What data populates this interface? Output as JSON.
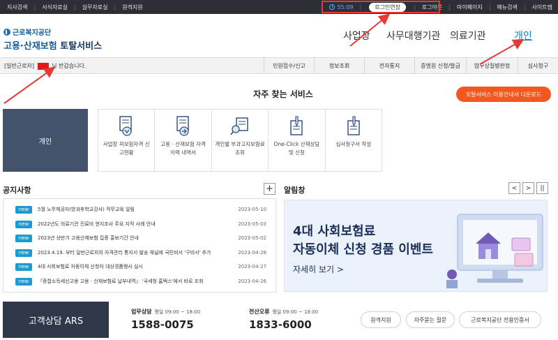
{
  "topbar": {
    "left_links": [
      "지사검색",
      "서식자료실",
      "실무자료실",
      "원격지원"
    ],
    "timer": "55:09",
    "extend_label": "로그인연장",
    "logout_label": "로그아웃",
    "right_links": [
      "마이페이지",
      "메뉴검색",
      "사이트맵"
    ]
  },
  "header": {
    "org_name": "근로복지공단",
    "service_name_blue": "고용·산재보험",
    "service_name_navy": "토탈서비스",
    "gnb": [
      "사업장",
      "사무대행기관",
      "의료기관",
      "개인"
    ],
    "active_gnb": "개인"
  },
  "subbar": {
    "welcome_prefix": "[일반근로자]",
    "welcome_suffix": "님 반갑습니다.",
    "menu": [
      "민원접수/신고",
      "정보조회",
      "전자통지",
      "증명원 신청/발급",
      "업무상질병판정",
      "심사청구"
    ]
  },
  "frequent": {
    "title": "자주 찾는 서비스",
    "download_label": "토탈서비스 이용안내서 다운로드",
    "personal_label": "개인",
    "services": [
      "사업장 피보험자격 신고현황",
      "고용 · 산재보험 자격 이력 내역서",
      "개인별 부과고지보험료 조회",
      "One-Click 산재상담 및 신청",
      "심사청구서 작성"
    ]
  },
  "notices": {
    "title": "공지사항",
    "plus_label": "+",
    "badge_label": "new",
    "items": [
      {
        "title": "5월 노무제공자(방과후학교강사) 직무교육 알림",
        "date": "2023-05-10"
      },
      {
        "title": "2022년도 의료기관 진료비 현지조사 주요 지적 사례 안내",
        "date": "2023-05-03"
      },
      {
        "title": "2023년 상반기 고용산재보험 집중 홍보기간 안내",
        "date": "2023-05-02"
      },
      {
        "title": "2023.4.19. 부터 일반근로자의 자격관리 통지서 발송 채널에 국민비서 '구비서' 추가",
        "date": "2023-04-28"
      },
      {
        "title": "4대 사회보험료 자동이체 신청자 대상경품행사 실시",
        "date": "2023-04-27"
      },
      {
        "title": "『종합소득세신고용 고용 · 산재보험료 납부내역』 '국세청 홈택스'에서 바로 조회",
        "date": "2023-04-26"
      }
    ]
  },
  "alerts": {
    "title": "알림창",
    "prev_label": "<",
    "next_label": ">",
    "pause_label": "||",
    "banner_line1": "4대 사회보험료",
    "banner_line2": "자동이체 신청 경품 이벤트",
    "banner_more": "자세히 보기 >"
  },
  "footer": {
    "ars_label": "고객상담 ARS",
    "contacts": [
      {
        "label": "업무상담",
        "hours": "평일 09:00 ~ 18:00",
        "number": "1588-0075"
      },
      {
        "label": "전산오류",
        "hours": "평일 09:00 ~ 18:00",
        "number": "1833-6000"
      }
    ],
    "pills": [
      "원격지원",
      "자주묻는 질문",
      "근로복지공단 전용인증서"
    ]
  },
  "colors": {
    "topbar_bg": "#2e2e36",
    "accent_blue": "#0b7fd4",
    "orange": "#f2581f",
    "badge_blue": "#1c9bd1",
    "annotation_red": "#e53935"
  }
}
